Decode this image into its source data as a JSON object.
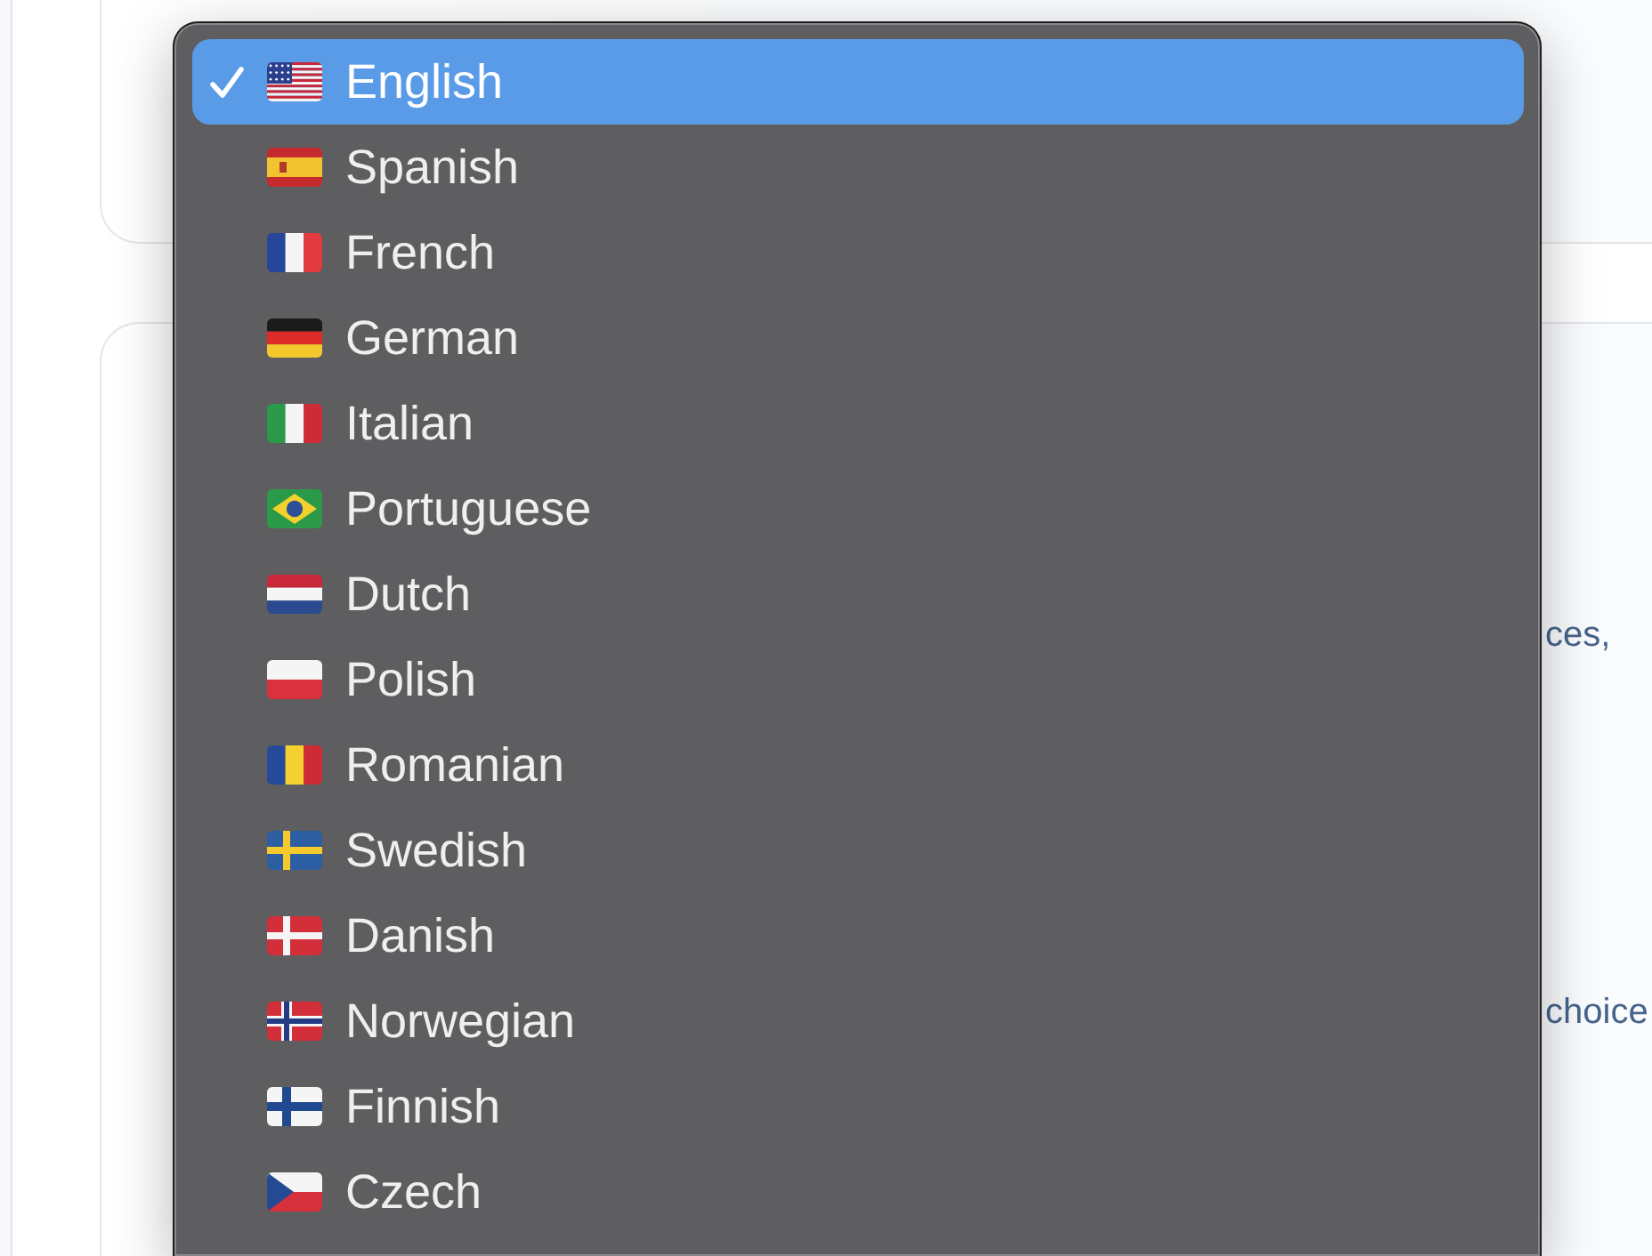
{
  "page": {
    "text_fragments": [
      "ces,",
      "choice"
    ]
  },
  "languages": [
    {
      "label": "English",
      "kind": "usa",
      "selected": true
    },
    {
      "label": "Spanish",
      "kind": "spain",
      "selected": false
    },
    {
      "label": "French",
      "kind": "france",
      "selected": false
    },
    {
      "label": "German",
      "kind": "germany",
      "selected": false
    },
    {
      "label": "Italian",
      "kind": "italy",
      "selected": false
    },
    {
      "label": "Portuguese",
      "kind": "brazil",
      "selected": false
    },
    {
      "label": "Dutch",
      "kind": "netherlands",
      "selected": false
    },
    {
      "label": "Polish",
      "kind": "poland",
      "selected": false
    },
    {
      "label": "Romanian",
      "kind": "romania",
      "selected": false
    },
    {
      "label": "Swedish",
      "kind": "sweden",
      "selected": false
    },
    {
      "label": "Danish",
      "kind": "denmark",
      "selected": false
    },
    {
      "label": "Norwegian",
      "kind": "norway",
      "selected": false
    },
    {
      "label": "Finnish",
      "kind": "finland",
      "selected": false
    },
    {
      "label": "Czech",
      "kind": "czechia",
      "selected": false
    }
  ]
}
